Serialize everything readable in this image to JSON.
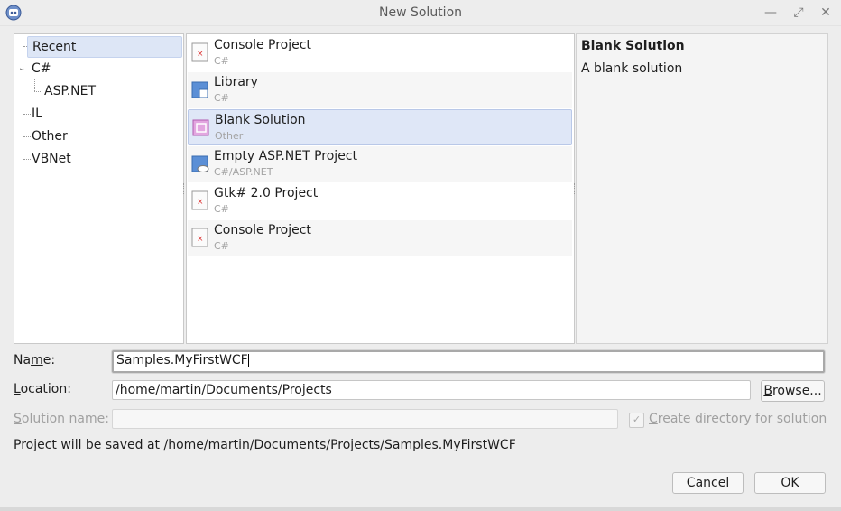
{
  "window": {
    "title": "New Solution",
    "controls": [
      "minimize-icon",
      "maximize-icon",
      "close-icon"
    ]
  },
  "categories": [
    {
      "label": "Recent",
      "selected": true,
      "level": 0
    },
    {
      "label": "C#",
      "expanded": true,
      "level": 0
    },
    {
      "label": "ASP.NET",
      "level": 1
    },
    {
      "label": "IL",
      "level": 0
    },
    {
      "label": "Other",
      "level": 0
    },
    {
      "label": "VBNet",
      "level": 0
    }
  ],
  "templates": [
    {
      "name": "Console Project",
      "language": "C#",
      "icon": "csharp-project-icon"
    },
    {
      "name": "Library",
      "language": "C#",
      "icon": "library-icon"
    },
    {
      "name": "Blank Solution",
      "language": "Other",
      "icon": "solution-icon",
      "selected": true
    },
    {
      "name": "Empty ASP.NET Project",
      "language": "C#/ASP.NET",
      "icon": "web-project-icon"
    },
    {
      "name": "Gtk# 2.0 Project",
      "language": "C#",
      "icon": "csharp-project-icon"
    },
    {
      "name": "Console Project",
      "language": "C#",
      "icon": "csharp-project-icon"
    }
  ],
  "description": {
    "title": "Blank Solution",
    "text": "A blank solution"
  },
  "form": {
    "name_label_pre": "Na",
    "name_label_u": "m",
    "name_label_post": "e:",
    "name_value": "Samples.MyFirstWCF",
    "location_label_pre": "",
    "location_label_u": "L",
    "location_label_post": "ocation:",
    "location_value": "/home/martin/Documents/Projects",
    "browse_pre": "",
    "browse_u": "B",
    "browse_post": "rowse...",
    "solution_label_pre": "",
    "solution_label_u": "S",
    "solution_label_post": "olution name:",
    "solution_value": "",
    "create_dir_pre": "",
    "create_dir_u": "C",
    "create_dir_post": "reate directory for solution",
    "create_dir_checked": true,
    "save_path": "Project will be saved at /home/martin/Documents/Projects/Samples.MyFirstWCF"
  },
  "buttons": {
    "cancel_pre": "",
    "cancel_u": "C",
    "cancel_post": "ancel",
    "ok_pre": "",
    "ok_u": "O",
    "ok_post": "K"
  },
  "colors": {
    "selection": "#dde6f6",
    "background": "#ededed"
  }
}
